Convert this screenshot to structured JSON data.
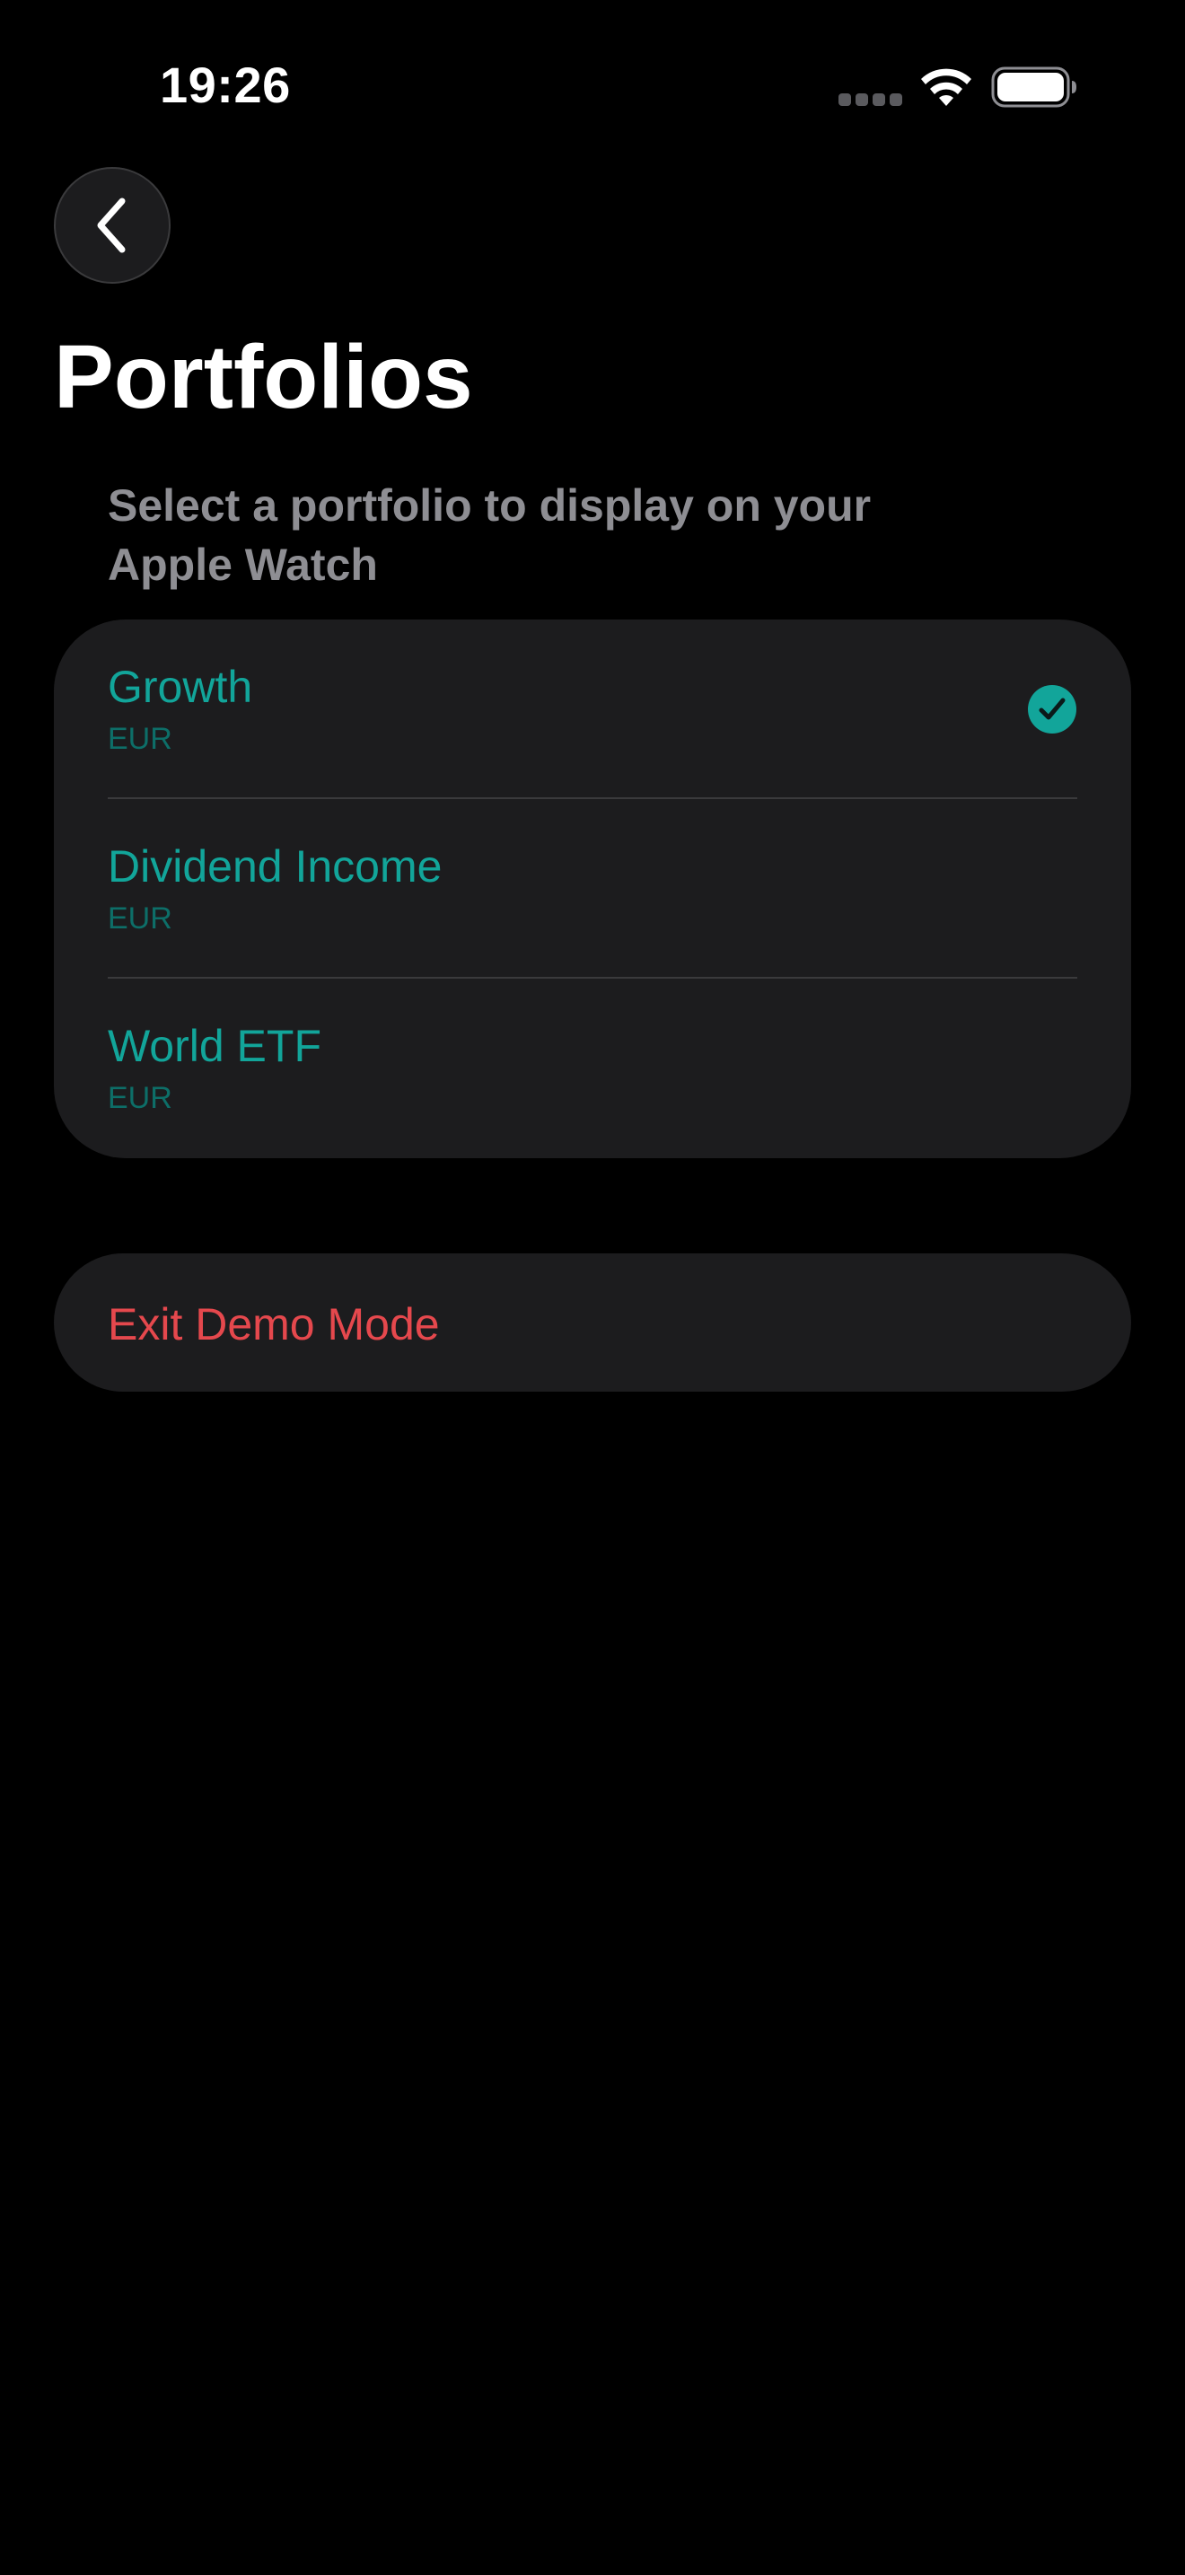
{
  "status_bar": {
    "time": "19:26",
    "icons": [
      "signal-dots-icon",
      "wifi-icon",
      "battery-icon"
    ]
  },
  "nav": {
    "back_icon": "chevron-left-icon"
  },
  "header": {
    "title": "Portfolios",
    "subtitle": "Select a portfolio to display on your Apple Watch"
  },
  "portfolios": [
    {
      "name": "Growth",
      "currency": "EUR",
      "selected": true
    },
    {
      "name": "Dividend Income",
      "currency": "EUR",
      "selected": false
    },
    {
      "name": "World ETF",
      "currency": "EUR",
      "selected": false
    }
  ],
  "actions": {
    "exit_demo_label": "Exit Demo Mode"
  },
  "colors": {
    "background": "#000000",
    "card": "#1c1c1e",
    "accent": "#12a59a",
    "destructive": "#e5484d",
    "secondary_text": "#8e8e93"
  }
}
